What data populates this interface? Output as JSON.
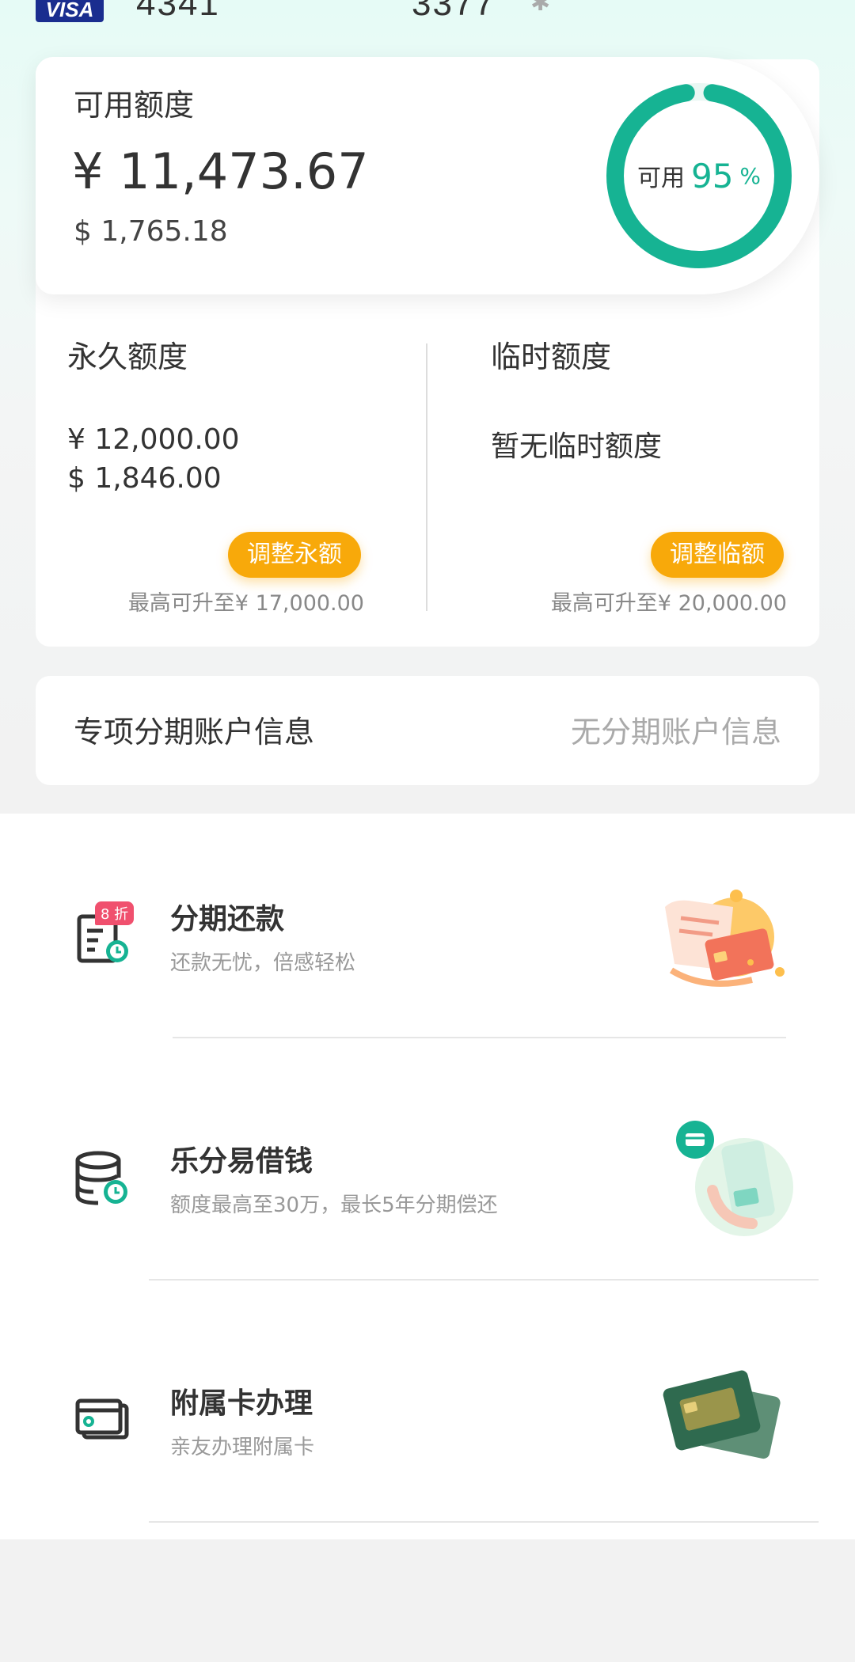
{
  "top_strip": {
    "card_brand": "VISA",
    "card_number_left": "4341",
    "card_number_right": "3377",
    "eye_icon": "eye-icon"
  },
  "available": {
    "title": "可用额度",
    "amount_cny": "¥ 11,473.67",
    "amount_usd": "$ 1,765.18",
    "ring_label": "可用",
    "ring_percent": "95",
    "ring_percent_sign": "%",
    "ring_fraction": 0.95,
    "accent_color": "#16b393"
  },
  "permanent": {
    "title": "永久额度",
    "amount_cny": "¥ 12,000.00",
    "amount_usd": "$ 1,846.00",
    "button_label": "调整永额",
    "max_text": "最高可升至¥ 17,000.00"
  },
  "temporary": {
    "title": "临时额度",
    "status": "暂无临时额度",
    "button_label": "调整临额",
    "max_text": "最高可升至¥ 20,000.00"
  },
  "installment_account": {
    "title": "专项分期账户信息",
    "value": "无分期账户信息"
  },
  "services": [
    {
      "title": "分期还款",
      "desc": "还款无忧，倍感轻松",
      "icon": "installment-bill-icon",
      "badge": "8 折"
    },
    {
      "title": "乐分易借钱",
      "desc": "额度最高至30万，最长5年分期偿还",
      "icon": "coins-clock-icon"
    },
    {
      "title": "附属卡办理",
      "desc": "亲友办理附属卡",
      "icon": "card-icon"
    }
  ],
  "colors": {
    "button_orange": "#f8a90a",
    "accent_green": "#16b393",
    "badge_red": "#f0506e"
  }
}
